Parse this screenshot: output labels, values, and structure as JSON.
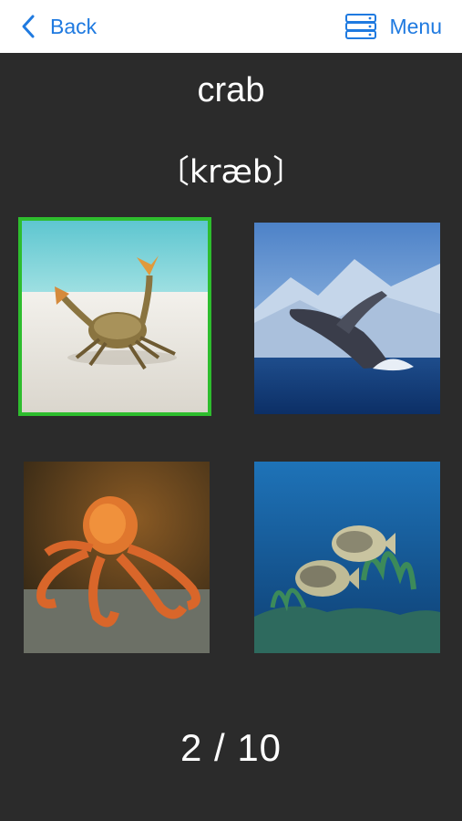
{
  "nav": {
    "back_label": "Back",
    "menu_label": "Menu",
    "accent_color": "#1f7ae0",
    "back_icon": "chevron-left-icon",
    "menu_icon": "server-stack-icon"
  },
  "card": {
    "word": "crab",
    "phonetic": "〔kræb〕"
  },
  "choices": [
    {
      "subject": "crab",
      "selected": true
    },
    {
      "subject": "whale",
      "selected": false
    },
    {
      "subject": "octopus",
      "selected": false
    },
    {
      "subject": "fish",
      "selected": false
    }
  ],
  "selection_color": "#2ebd2e",
  "progress": {
    "text": "2 / 10",
    "current": 2,
    "total": 10
  }
}
